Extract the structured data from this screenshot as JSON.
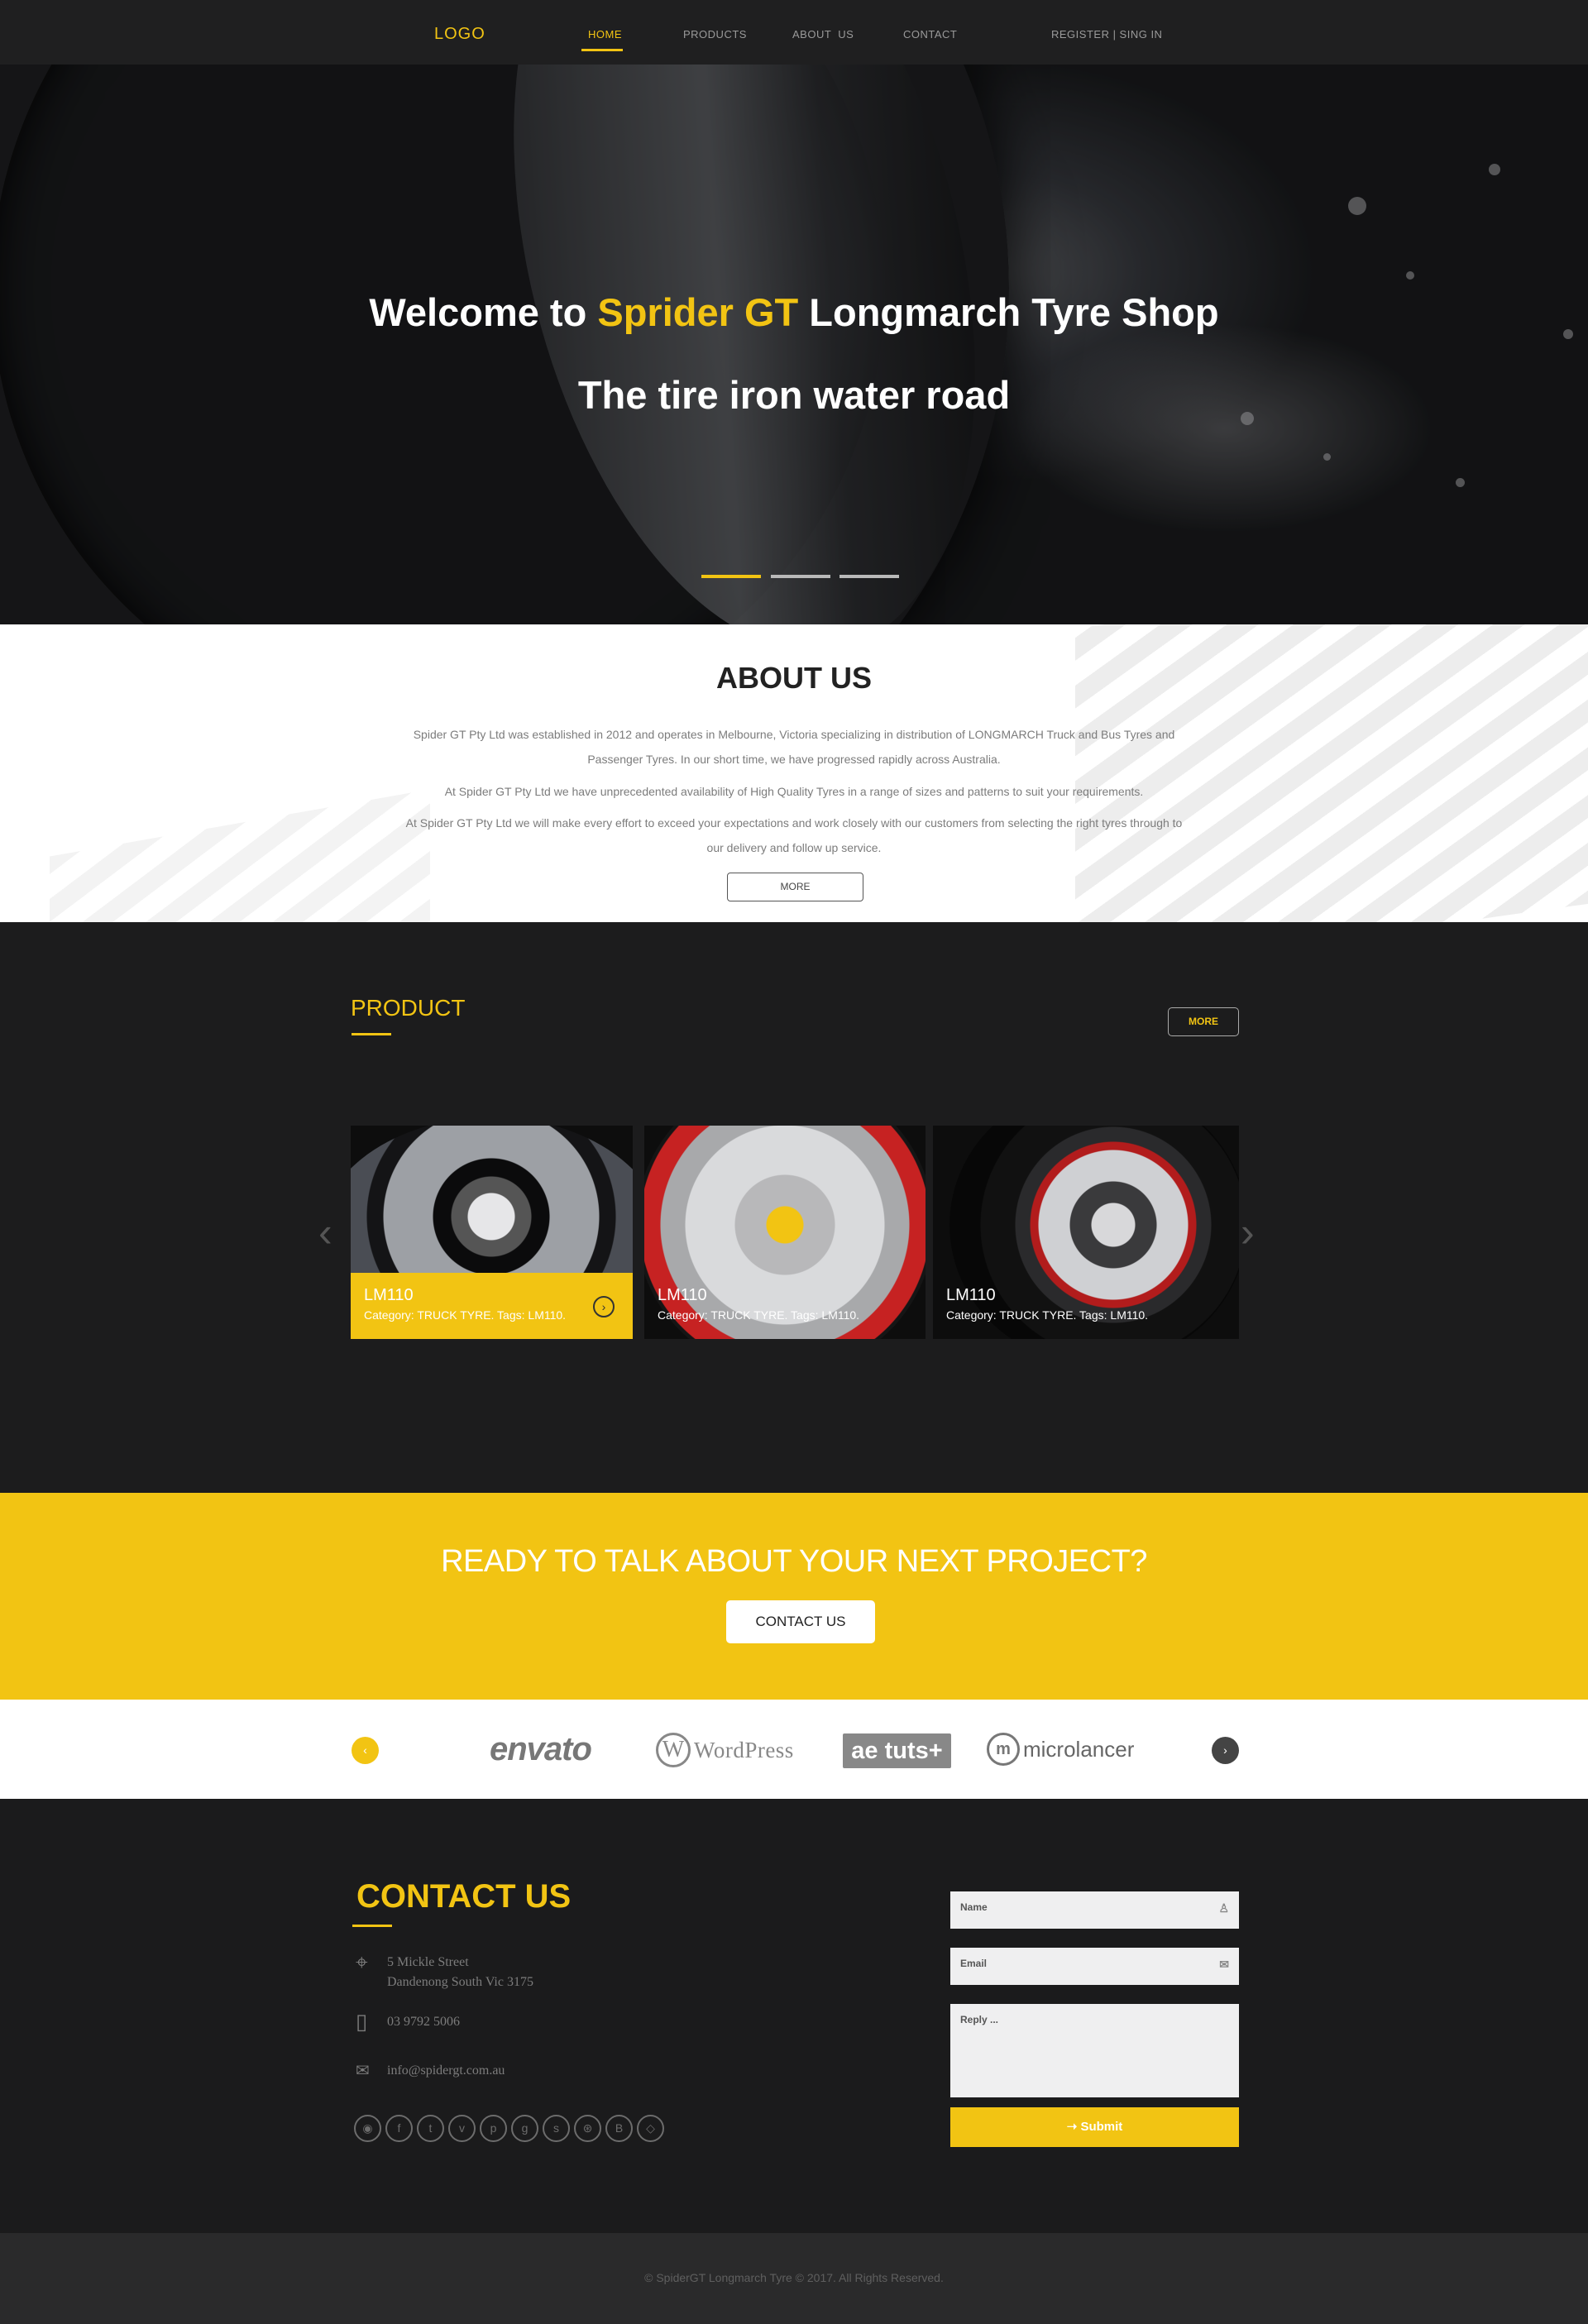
{
  "nav": {
    "logo": "LOGO",
    "items": [
      "HOME",
      "PRODUCTS",
      "ABOUT  US",
      "CONTACT"
    ],
    "auth": "REGISTER | SING IN"
  },
  "hero": {
    "title_pre": "Welcome to ",
    "title_accent": "Sprider GT",
    "title_post": " Longmarch Tyre Shop",
    "subtitle": "The tire iron water road",
    "slides_active": 1,
    "slides_total": 3
  },
  "about": {
    "title": "ABOUT US",
    "paragraphs": [
      "Spider GT Pty Ltd was established in 2012 and operates in Melbourne, Victoria specializing in distribution of LONGMARCH Truck and Bus Tyres and Passenger Tyres. In our short time, we have progressed rapidly across Australia.",
      "At Spider GT Pty Ltd we have unprecedented availability of High Quality Tyres in a range of sizes and patterns to suit your requirements.",
      "At Spider GT Pty Ltd we will make every effort to exceed your expectations and work closely with our customers from selecting the right tyres through to our delivery and follow up service."
    ],
    "more": "MORE"
  },
  "product": {
    "title": "PRODUCT",
    "more": "MORE",
    "prev_icon": "chevron-left-icon",
    "next_icon": "chevron-right-icon",
    "items": [
      {
        "name": "LM110",
        "meta": "Category: TRUCK TYRE.  Tags: LM110."
      },
      {
        "name": "LM110",
        "meta": "Category: TRUCK TYRE.  Tags: LM110."
      },
      {
        "name": "LM110",
        "meta": "Category: TRUCK TYRE.  Tags: LM110."
      }
    ]
  },
  "cta": {
    "title": "READY TO TALK ABOUT YOUR NEXT PROJECT?",
    "button": "CONTACT US"
  },
  "partners": {
    "logos": [
      "envato",
      "WordPress",
      "ae tuts+",
      "microlancer"
    ],
    "wp_mark": "W",
    "micro_mark": "m"
  },
  "contact": {
    "title": "CONTACT US",
    "address_line1": "5 Mickle Street",
    "address_line2": "Dandenong South Vic 3175",
    "phone": "03 9792 5006",
    "email": "info@spidergt.com.au",
    "socials": [
      "rss-icon",
      "facebook-icon",
      "twitter-icon",
      "vimeo-icon",
      "pinterest-icon",
      "google-plus-icon",
      "skype-icon",
      "dribbble-icon",
      "behance-icon",
      "dropbox-icon"
    ],
    "form": {
      "name_placeholder": "Name",
      "email_placeholder": "Email",
      "reply_placeholder": "Reply ...",
      "submit": "Submit"
    }
  },
  "footer": {
    "copyright": "© SpiderGT Longmarch Tyre © 2017. All Rights Reserved."
  },
  "colors": {
    "accent": "#f2c413",
    "dark": "#1c1c1d",
    "white": "#ffffff"
  }
}
